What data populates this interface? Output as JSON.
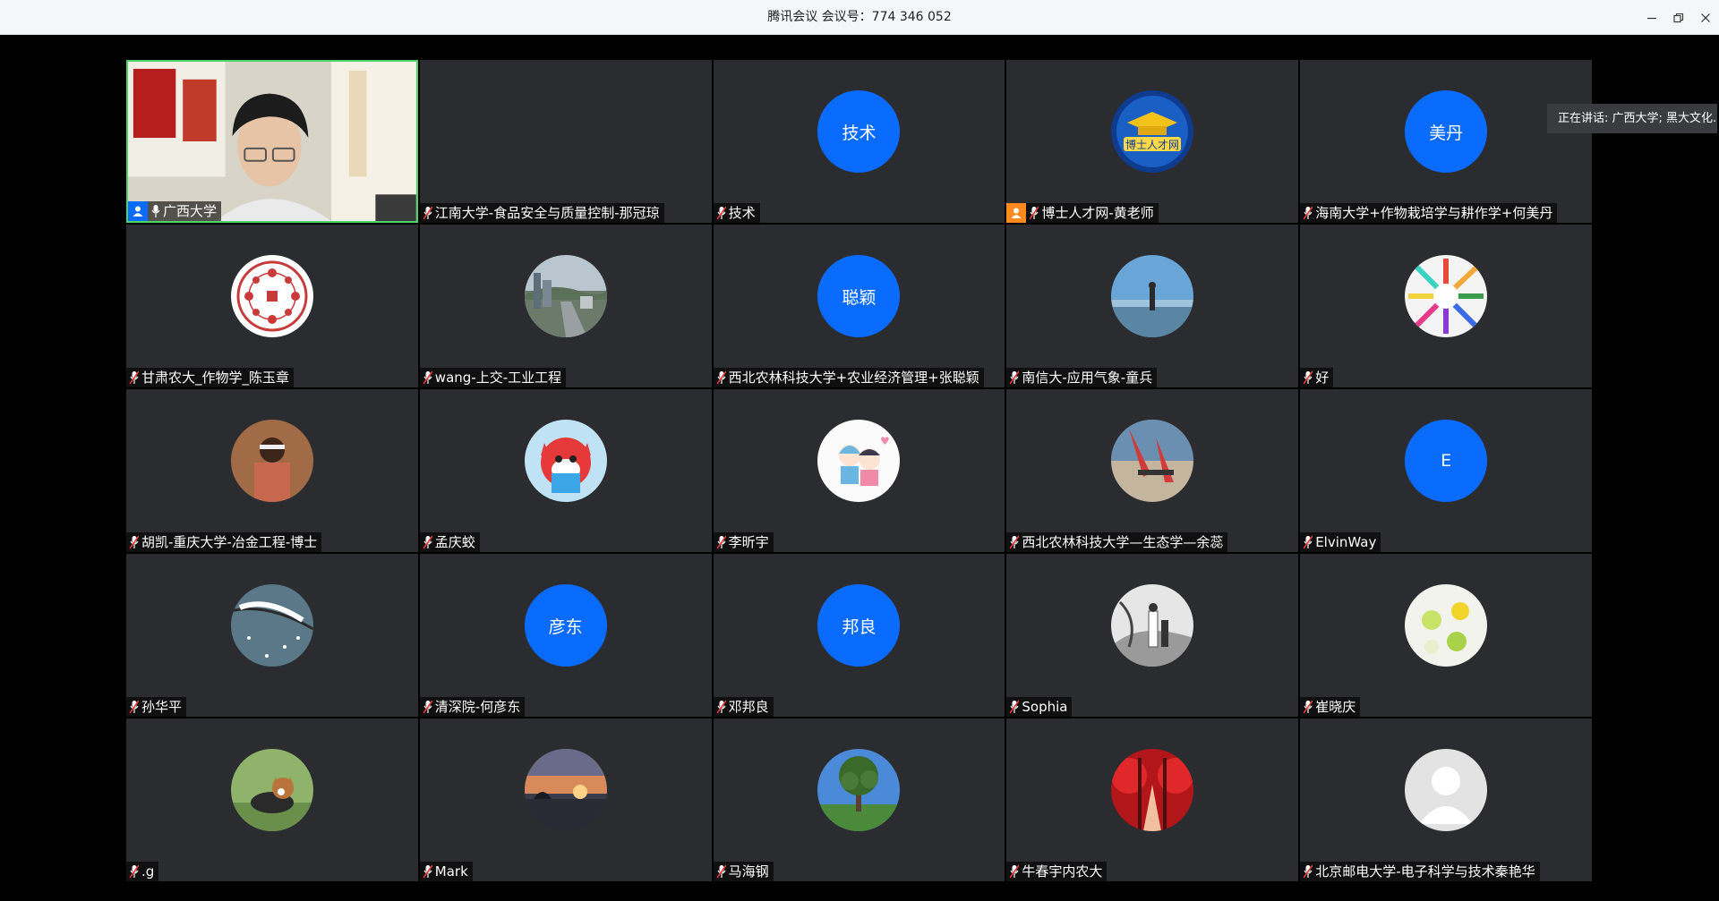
{
  "window": {
    "title": "腾讯会议 会议号：774 346 052"
  },
  "speaking_indicator": "正在讲话: 广西大学; 黑大文化...",
  "colors": {
    "avatar_blue": "#0a6cff",
    "tile_bg": "#2b2c2f",
    "active_border": "#4fd26b"
  },
  "participants": [
    {
      "name": "广西大学",
      "role": "host-icon",
      "video": true,
      "muted": false
    },
    {
      "name": "江南大学-食品安全与质量控制-那冠琼",
      "avatar": "none",
      "muted": true
    },
    {
      "name": "技术",
      "avatar_text": "技术",
      "muted": true
    },
    {
      "name": "博士人才网-黄老师",
      "role": "cohost-icon",
      "avatar": "logo-image",
      "avatar_caption": "博士人才网",
      "muted": true
    },
    {
      "name": "海南大学+作物栽培学与耕作学+何美丹",
      "avatar_text": "美丹",
      "muted": true
    },
    {
      "name": "甘肃农大_作物学_陈玉章",
      "avatar": "seal-image",
      "muted": true
    },
    {
      "name": "wang-上交-工业工程",
      "avatar": "city-image",
      "muted": true
    },
    {
      "name": "西北农林科技大学+农业经济管理+张聪颖",
      "avatar_text": "聪颖",
      "muted": true
    },
    {
      "name": "南信大-应用气象-童兵",
      "avatar": "beach-image",
      "muted": true
    },
    {
      "name": "好",
      "avatar": "pencils-image",
      "muted": true
    },
    {
      "name": "胡凯-重庆大学-冶金工程-博士",
      "avatar": "portrait-image",
      "muted": true
    },
    {
      "name": "孟庆蛟",
      "avatar": "cartoon-fox-image",
      "muted": true
    },
    {
      "name": "李昕宇",
      "avatar": "cartoon-couple-image",
      "muted": true
    },
    {
      "name": "西北农林科技大学—生态学—余蕊",
      "avatar": "dancer-image",
      "muted": true
    },
    {
      "name": "ElvinWay",
      "avatar_text": "E",
      "muted": true
    },
    {
      "name": "孙华平",
      "avatar": "snow-branch-image",
      "muted": true
    },
    {
      "name": "清深院-何彦东",
      "avatar_text": "彦东",
      "muted": true
    },
    {
      "name": "邓邦良",
      "avatar_text": "邦良",
      "muted": true
    },
    {
      "name": "Sophia",
      "avatar": "ink-painting-image",
      "muted": true
    },
    {
      "name": "崔晓庆",
      "avatar": "lemons-image",
      "muted": true
    },
    {
      "name": ".g",
      "avatar": "dog-image",
      "muted": true
    },
    {
      "name": "Mark",
      "avatar": "sunset-image",
      "muted": true
    },
    {
      "name": "马海钢",
      "avatar": "tree-image",
      "muted": true
    },
    {
      "name": "牛春宇内农大",
      "avatar": "red-forest-image",
      "muted": true
    },
    {
      "name": "北京邮电大学-电子科学与技术秦艳华",
      "avatar": "default-person-icon",
      "muted": true
    }
  ]
}
